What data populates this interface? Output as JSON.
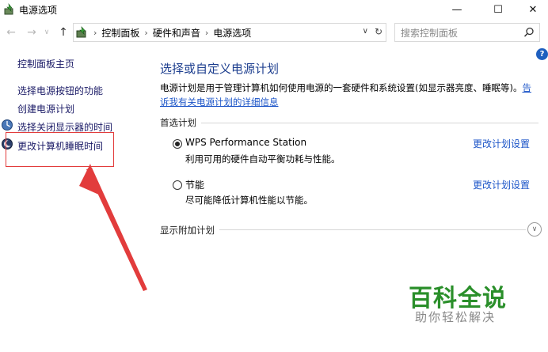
{
  "window": {
    "title": "电源选项",
    "minimize_glyph": "—",
    "maximize_glyph": "☐",
    "close_glyph": "✕"
  },
  "nav": {
    "back_glyph": "←",
    "forward_glyph": "→",
    "recent_glyph": "∨",
    "up_glyph": "↑",
    "breadcrumbs": [
      "控制面板",
      "硬件和声音",
      "电源选项"
    ],
    "separator": "›",
    "dropdown_glyph": "∨",
    "refresh_glyph": "↻"
  },
  "search": {
    "placeholder": "搜索控制面板"
  },
  "sidebar": {
    "home": "控制面板主页",
    "items": [
      {
        "label": "选择电源按钮的功能"
      },
      {
        "label": "创建电源计划"
      },
      {
        "label": "选择关闭显示器的时间"
      },
      {
        "label": "更改计算机睡眠时间"
      }
    ]
  },
  "help": {
    "glyph": "?"
  },
  "main": {
    "heading": "选择或自定义电源计划",
    "description": "电源计划是用于管理计算机如何使用电源的一套硬件和系统设置(如显示器亮度、睡眠等)。",
    "description_link": "告诉我有关电源计划的详细信息",
    "preferred_label": "首选计划",
    "plans": [
      {
        "name": "WPS Performance Station",
        "description": "利用可用的硬件自动平衡功耗与性能。",
        "change_label": "更改计划设置",
        "selected": true
      },
      {
        "name": "节能",
        "description": "尽可能降低计算机性能以节能。",
        "change_label": "更改计划设置",
        "selected": false
      }
    ],
    "extra_label": "显示附加计划",
    "expand_glyph": "∨"
  },
  "watermark": {
    "title": "百科全说",
    "subtitle": "助你轻松解决"
  },
  "colors": {
    "link": "#1c55c8",
    "heading": "#1e3f8f",
    "highlight": "#e23c3c",
    "watermark": "#2a8f2a"
  }
}
